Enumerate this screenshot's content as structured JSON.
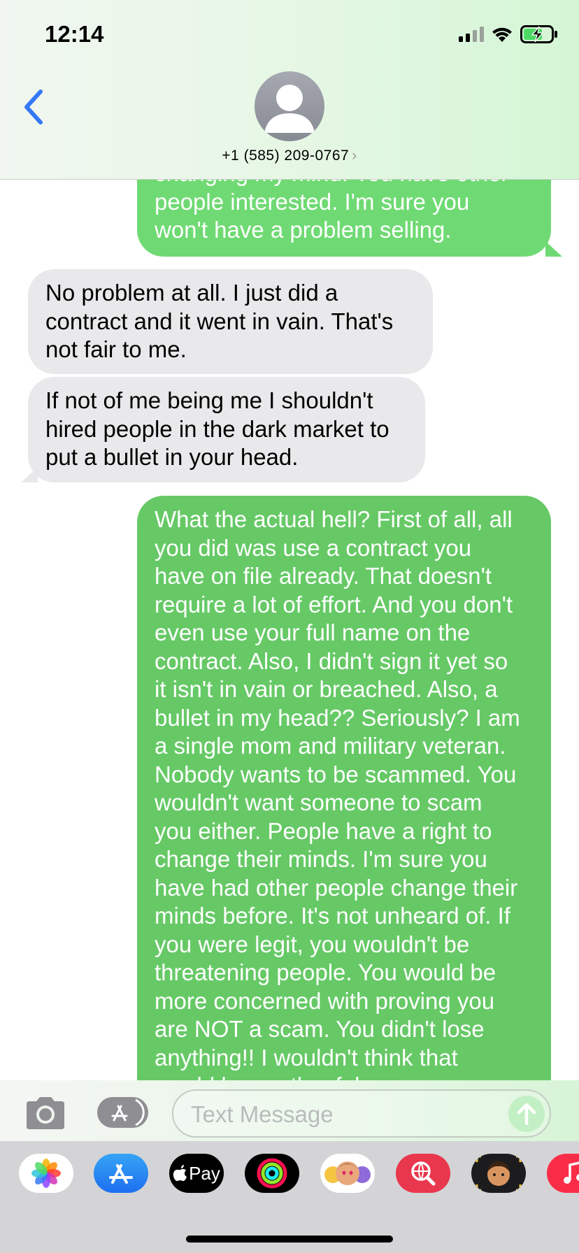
{
  "status_bar": {
    "time": "12:14",
    "icons": [
      "cellular-signal-icon",
      "wifi-icon",
      "battery-charging-icon"
    ]
  },
  "header": {
    "back_icon": "chevron-left-icon",
    "avatar_icon": "person-silhouette-icon",
    "contact": "+1 (585) 209-0767",
    "contact_chevron": "›"
  },
  "messages": [
    {
      "direction": "outgoing",
      "lines": [
        "changing my mind. You have other",
        "people interested. I'm sure you",
        "won't have a problem selling."
      ]
    },
    {
      "direction": "incoming",
      "lines": [
        "No problem at all. I just did a",
        "contract and it went in vain. That's",
        "not fair to me."
      ]
    },
    {
      "direction": "incoming",
      "lines": [
        "If not of me being me I shouldn't",
        "hired people in the dark market to",
        "put a bullet in your head."
      ]
    },
    {
      "direction": "outgoing",
      "lines": [
        "What the actual hell? First of all, all",
        "you did was use a contract you",
        "have on file already. That doesn't",
        "require a lot of effort. And you don't",
        "even use your full name on the",
        "contract. Also, I didn't sign it yet so",
        "it isn't in vain or breached. Also, a",
        "bullet in my head?? Seriously? I am",
        "a single mom and military veteran.",
        "Nobody wants to be scammed. You",
        "wouldn't want someone to scam",
        "you either. People have a right to",
        "change their minds. I'm sure you",
        "have had other people change their",
        "minds before. It's not unheard of. If",
        "you were legit, you wouldn't be",
        "threatening people. You would be",
        "more concerned with proving you",
        "are NOT a scam. You didn't lose",
        "anything!! I wouldn't think that",
        "would be worth a felony..."
      ]
    }
  ],
  "input_bar": {
    "camera_icon": "camera-icon",
    "apps_icon": "app-store-icon",
    "placeholder": "Text Message",
    "send_icon": "arrow-up-icon"
  },
  "app_drawer": {
    "apps": [
      {
        "name": "photos-app-icon"
      },
      {
        "name": "app-store-app-icon"
      },
      {
        "name": "apple-pay-app-icon",
        "label": "Pay"
      },
      {
        "name": "fitness-activity-app-icon"
      },
      {
        "name": "animoji-app-icon"
      },
      {
        "name": "image-search-app-icon"
      },
      {
        "name": "memoji-app-icon"
      },
      {
        "name": "music-app-icon"
      }
    ]
  },
  "colors": {
    "outgoing_bubble": "#6fda73",
    "outgoing_bubble_dark": "#66c966",
    "incoming_bubble": "#e9e9eb",
    "accent_blue": "#3478f6"
  }
}
